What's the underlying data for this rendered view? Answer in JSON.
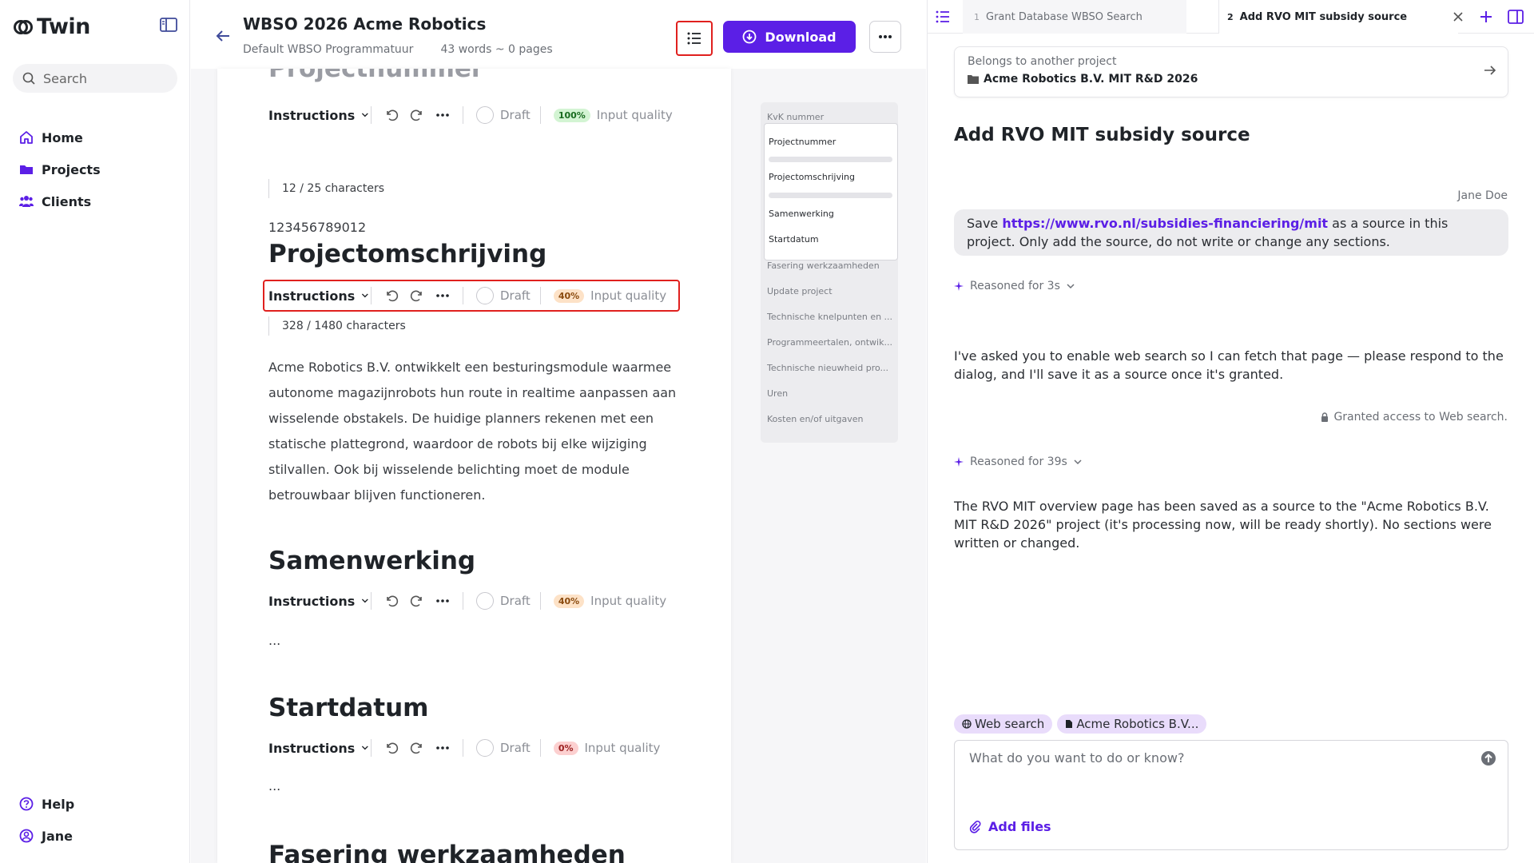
{
  "app": {
    "name": "Twin"
  },
  "sidebar": {
    "search_label": "Search",
    "nav": [
      {
        "label": "Home",
        "icon": "home-icon"
      },
      {
        "label": "Projects",
        "icon": "folder-icon"
      },
      {
        "label": "Clients",
        "icon": "users-icon"
      }
    ],
    "bottom": [
      {
        "label": "Help",
        "icon": "help-icon"
      },
      {
        "label": "Jane",
        "icon": "user-icon"
      }
    ]
  },
  "doc": {
    "title": "WBSO 2026 Acme Robotics",
    "template": "Default WBSO Programmatuur",
    "stats": "43 words ~ 0 pages",
    "download_label": "Download"
  },
  "toolbar": {
    "instructions_label": "Instructions",
    "draft_label": "Draft",
    "quality_label": "Input quality"
  },
  "sections": [
    {
      "title": "Projectnummer",
      "quality": "100%",
      "chars": "12 / 25 characters",
      "value": "123456789012"
    },
    {
      "title": "Projectomschrijving",
      "quality": "40%",
      "chars": "328 / 1480 characters",
      "value": "Acme Robotics B.V. ontwikkelt een besturingsmodule waarmee autonome magazijnrobots hun route in realtime aanpassen aan wisselende obstakels. De huidige planners rekenen met een statische plattegrond, waardoor de robots bij elke wijziging stilvallen. Ook bij wisselende belichting moet de module betrouwbaar blijven functioneren."
    },
    {
      "title": "Samenwerking",
      "quality": "40%",
      "value": "..."
    },
    {
      "title": "Startdatum",
      "quality": "0%",
      "value": "..."
    },
    {
      "title": "Fasering werkzaamheden"
    }
  ],
  "outline": {
    "above": "KvK nummer",
    "card": [
      "Projectnummer",
      "Projectomschrijving",
      "Samenwerking",
      "Startdatum"
    ],
    "below": [
      "Fasering werkzaamheden",
      "Update project",
      "Technische knelpunten en ...",
      "Programmeertalen, ontwik...",
      "Technische nieuwheid pro...",
      "Uren",
      "Kosten en/of uitgaven"
    ]
  },
  "chat": {
    "tabs": [
      {
        "num": "1",
        "label": "Grant Database WBSO Search"
      },
      {
        "num": "2",
        "label": "Add RVO MIT subsidy source"
      }
    ],
    "project_card": {
      "label": "Belongs to another project",
      "value": "Acme Robotics B.V. MIT R&D 2026"
    },
    "title": "Add RVO MIT subsidy source",
    "user_name": "Jane Doe",
    "user_msg_pre": "Save ",
    "user_msg_link": "https://www.rvo.nl/subsidies-financiering/mit",
    "user_msg_post": " as a source in this project. Only add the source, do not write or change any sections.",
    "reasoned_1": "Reasoned for 3s",
    "ai_msg_1": "I've asked you to enable web search so I can fetch that page — please respond to the dialog, and I'll save it as a source once it's granted.",
    "granted": "Granted access to Web search.",
    "reasoned_2": "Reasoned for 39s",
    "ai_msg_2": "The RVO MIT overview page has been saved as a source to the \"Acme Robotics B.V. MIT R&D 2026\" project (it's processing now, will be ready shortly). No sections were written or changed.",
    "chips": [
      "Web search",
      "Acme Robotics B.V..."
    ],
    "composer_placeholder": "What do you want to do or know?",
    "add_files": "Add files"
  },
  "colors": {
    "accent": "#5b1fe6",
    "highlight": "#e0201e",
    "chip": "#e9dcfb"
  }
}
